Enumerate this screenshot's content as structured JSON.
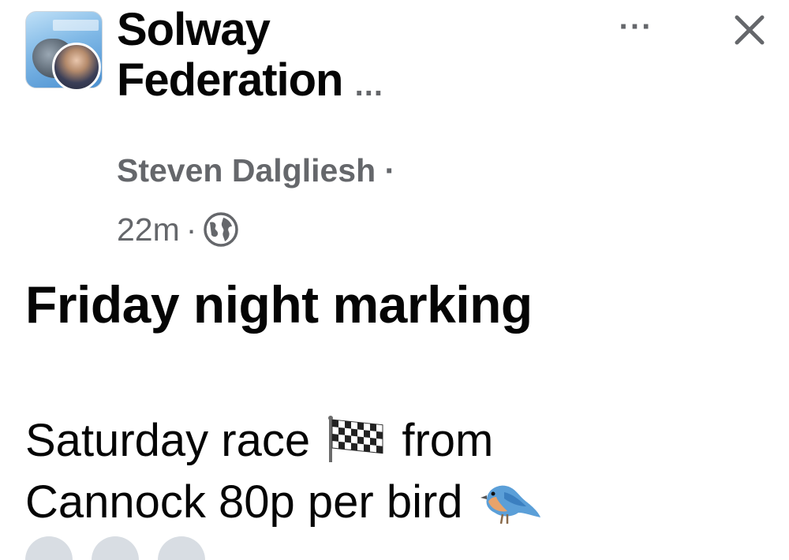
{
  "post": {
    "group_name_line1": "Solway",
    "group_name_line2": "Federation",
    "group_name_more": "...",
    "author": "Steven Dalgliesh",
    "author_separator": "·",
    "time": "22m",
    "time_separator": "·",
    "privacy_icon": "globe-icon",
    "more_label": "···",
    "close_icon": "close-icon",
    "title": "Friday night marking",
    "body_line1_a": "Saturday race",
    "body_line1_b": "from",
    "body_line2": "Cannock 80p per bird",
    "emoji_1": "chequered-flag-icon",
    "emoji_2": "bluebird-icon"
  },
  "colors": {
    "text_primary": "#050505",
    "text_secondary": "#65676b",
    "background": "#ffffff"
  }
}
